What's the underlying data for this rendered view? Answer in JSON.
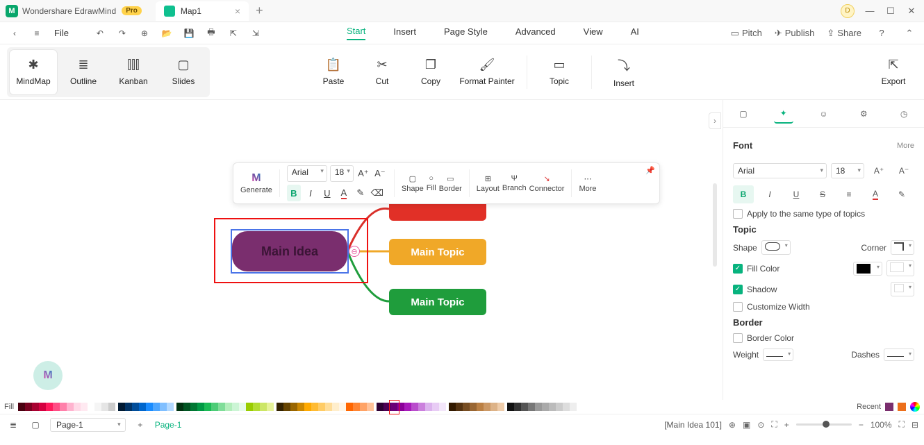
{
  "title": {
    "app_name": "Wondershare EdrawMind",
    "pro": "Pro",
    "doc_tab": "Map1",
    "avatar": "D"
  },
  "menu": {
    "file": "File",
    "tabs": [
      "Start",
      "Insert",
      "Page Style",
      "Advanced",
      "View",
      "AI"
    ],
    "right": {
      "pitch": "Pitch",
      "publish": "Publish",
      "share": "Share"
    }
  },
  "ribbon": {
    "views": [
      "MindMap",
      "Outline",
      "Kanban",
      "Slides"
    ],
    "actions": [
      "Paste",
      "Cut",
      "Copy",
      "Format Painter"
    ],
    "topic": "Topic",
    "insert": "Insert",
    "export": "Export"
  },
  "float": {
    "generate": "Generate",
    "font": "Arial",
    "size": "18",
    "shape": "Shape",
    "fill": "Fill",
    "border": "Border",
    "layout": "Layout",
    "branch": "Branch",
    "connector": "Connector",
    "more": "More"
  },
  "nodes": {
    "main": "Main Idea",
    "t1": "",
    "t2": "Main Topic",
    "t3": "Main Topic"
  },
  "panel": {
    "font_title": "Font",
    "more": "More",
    "font": "Arial",
    "size": "18",
    "apply_same": "Apply to the same type of topics",
    "topic_title": "Topic",
    "shape": "Shape",
    "corner": "Corner",
    "fill_color": "Fill Color",
    "shadow": "Shadow",
    "customize_width": "Customize Width",
    "border_title": "Border",
    "border_color": "Border Color",
    "weight": "Weight",
    "dashes": "Dashes"
  },
  "colorstrip": {
    "fill": "Fill",
    "recent": "Recent"
  },
  "bottom": {
    "page_sel": "Page-1",
    "page_active": "Page-1",
    "selection": "[Main Idea 101]",
    "zoom": "100%"
  }
}
